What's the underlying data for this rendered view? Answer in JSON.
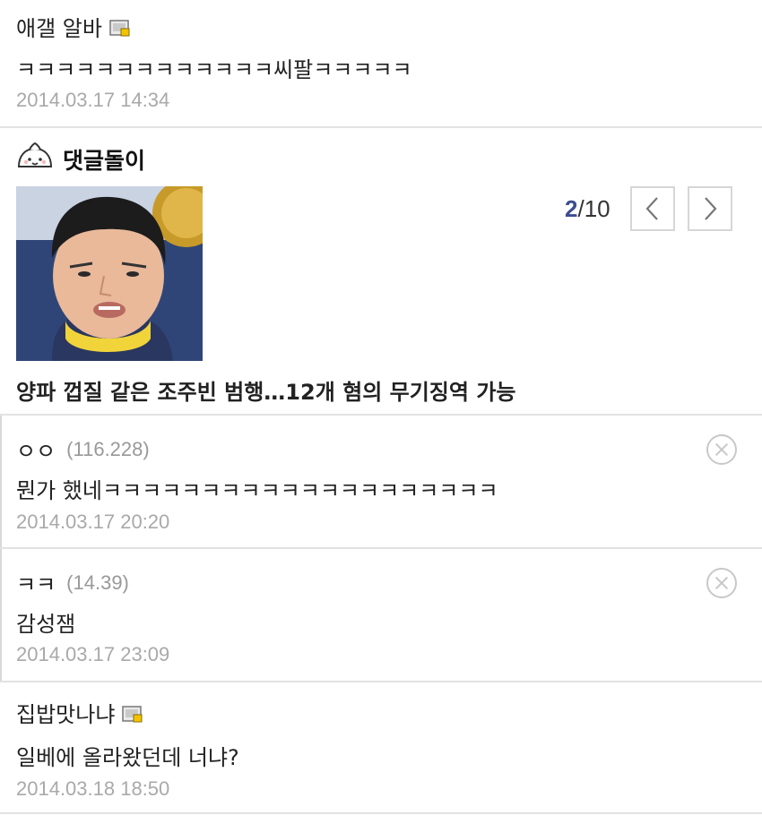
{
  "comments": [
    {
      "author": "애갤 알바",
      "text": "ㅋㅋㅋㅋㅋㅋㅋㅋㅋㅋㅋㅋㅋ씨팔ㅋㅋㅋㅋㅋ",
      "date": "2014.03.17 14:34"
    },
    {
      "author": "ㅇㅇ",
      "ip": "(116.228)",
      "text": "뭔가 했네ㅋㅋㅋㅋㅋㅋㅋㅋㅋㅋㅋㅋㅋㅋㅋㅋㅋㅋㅋㅋ",
      "date": "2014.03.17 20:20"
    },
    {
      "author": "ㅋㅋ",
      "ip": "(14.39)",
      "text": "감성잼",
      "date": "2014.03.17 23:09"
    },
    {
      "author": "집밥맛나냐",
      "text": "일베에 올라왔던데 너냐?",
      "date": "2014.03.18 18:50"
    }
  ],
  "bot": {
    "label": "댓글돌이",
    "pager_current": "2",
    "pager_total": "/10",
    "headline": "양파 껍질 같은 조주빈 범행…12개 혐의 무기징역 가능"
  },
  "icons": {
    "memo": "memo-icon",
    "bot": "dumpling-icon",
    "prev": "chevron-left-icon",
    "next": "chevron-right-icon",
    "delete": "close-circle-icon"
  },
  "colors": {
    "pager_accent": "#3c4d8f",
    "date": "#a9a9a9",
    "divider": "#e2e2e2"
  }
}
